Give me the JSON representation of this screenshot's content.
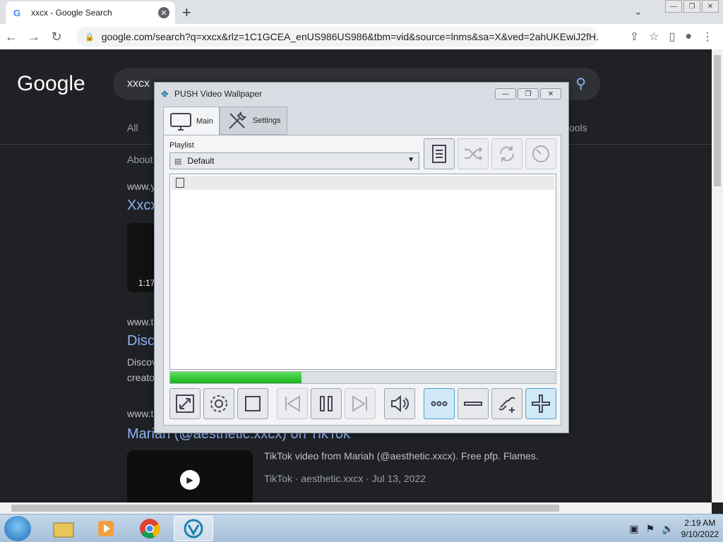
{
  "browser": {
    "tab_title": "xxcx - Google Search",
    "new_tab": "+",
    "url": "google.com/search?q=xxcx&rlz=1C1GCEA_enUS986US986&tbm=vid&source=lnms&sa=X&ved=2ahUKEwiJ2fH..."
  },
  "google": {
    "logo": "Google",
    "query": "xxcx",
    "nav_all": "All",
    "nav_tools": "ools",
    "about": "About",
    "result1_url": "www.y",
    "result1_title": "Xxcx",
    "result1_duration": "1:17",
    "result2_url": "www.t",
    "result2_title": "Disco",
    "result2_text1": "Discov",
    "result2_text2": "creato",
    "result3_url": "www.t",
    "result3_title": "Mariah (@aesthetic.xxcx) on TikTok",
    "result3_desc": "TikTok video from Mariah (@aesthetic.xxcx). Free pfp. Flames.",
    "result3_meta": "TikTok · aesthetic.xxcx · Jul 13, 2022"
  },
  "app": {
    "title": "PUSH Video Wallpaper",
    "tab_main": "Main",
    "tab_settings": "Settings",
    "playlist_label": "Playlist",
    "playlist_selected": "Default",
    "playlist_items": [
      ""
    ],
    "progress": 0.34
  },
  "taskbar": {
    "time": "2:19 AM",
    "date": "9/10/2022"
  }
}
